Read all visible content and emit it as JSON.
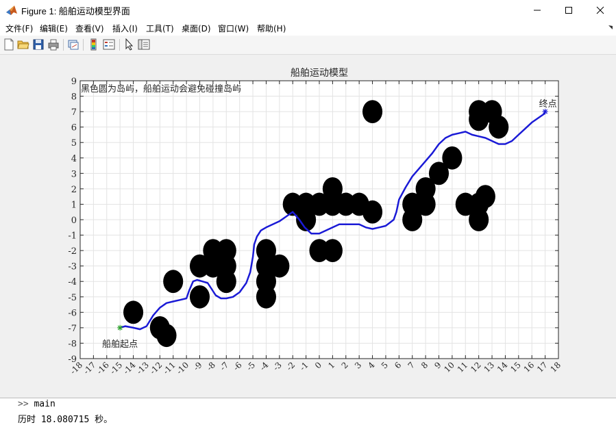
{
  "window": {
    "title": "Figure 1: 船舶运动模型界面"
  },
  "menu": [
    "文件(F)",
    "编辑(E)",
    "查看(V)",
    "插入(I)",
    "工具(T)",
    "桌面(D)",
    "窗口(W)",
    "帮助(H)"
  ],
  "toolbar": {
    "icons": [
      "new-figure-icon",
      "open-file-icon",
      "save-icon",
      "print-icon",
      "link-plot-icon",
      "colorbar-icon",
      "legend-icon",
      "edit-plot-icon",
      "property-inspector-icon"
    ]
  },
  "console": {
    "prompt": ">>",
    "command": "main",
    "output": "历时 18.080715 秒。"
  },
  "colors": {
    "path": "#1a1ad6",
    "island": "#000000",
    "start_marker": "#2ca02c",
    "end_marker": "#1a1ad6",
    "grid": "#e3e3e3",
    "axes_text": "#262626"
  },
  "chart_data": {
    "type": "line",
    "title": "船舶运动模型",
    "annotation": "黑色圆为岛屿，船舶运动会避免碰撞岛屿",
    "start_label": "船舶起点",
    "end_label": "终点",
    "xlim": [
      -18,
      18
    ],
    "ylim": [
      -9,
      9
    ],
    "x_ticks": [
      -18,
      -17,
      -16,
      -15,
      -14,
      -13,
      -12,
      -11,
      -10,
      -9,
      -8,
      -7,
      -6,
      -5,
      -4,
      -3,
      -2,
      -1,
      0,
      1,
      2,
      3,
      4,
      5,
      6,
      7,
      8,
      9,
      10,
      11,
      12,
      13,
      14,
      15,
      16,
      17,
      18
    ],
    "y_ticks": [
      -9,
      -8,
      -7,
      -6,
      -5,
      -4,
      -3,
      -2,
      -1,
      0,
      1,
      2,
      3,
      4,
      5,
      6,
      7,
      8,
      9
    ],
    "grid": true,
    "start": [
      -15,
      -7
    ],
    "end": [
      17,
      7
    ],
    "island_radius": 0.75,
    "islands": [
      [
        -14,
        -6
      ],
      [
        -12,
        -7
      ],
      [
        -11.5,
        -7.5
      ],
      [
        -11,
        -4
      ],
      [
        -9,
        -3
      ],
      [
        -9,
        -5
      ],
      [
        -8,
        -2
      ],
      [
        -8,
        -3
      ],
      [
        -7,
        -2
      ],
      [
        -7,
        -3
      ],
      [
        -7,
        -4
      ],
      [
        -4,
        -2
      ],
      [
        -4,
        -3
      ],
      [
        -4,
        -4
      ],
      [
        -4,
        -5
      ],
      [
        -3,
        -3
      ],
      [
        -2,
        1
      ],
      [
        -1,
        1
      ],
      [
        -1,
        0
      ],
      [
        0,
        1
      ],
      [
        1,
        1
      ],
      [
        1,
        2
      ],
      [
        2,
        1
      ],
      [
        3,
        1
      ],
      [
        4,
        0.5
      ],
      [
        4,
        7
      ],
      [
        0,
        -2
      ],
      [
        1,
        -2
      ],
      [
        7,
        1
      ],
      [
        7,
        0
      ],
      [
        8,
        1
      ],
      [
        8,
        2
      ],
      [
        9,
        3
      ],
      [
        10,
        4
      ],
      [
        11,
        1
      ],
      [
        12,
        1
      ],
      [
        12,
        0
      ],
      [
        12.5,
        1.5
      ],
      [
        12,
        7
      ],
      [
        12,
        6.5
      ],
      [
        13,
        7
      ],
      [
        13.5,
        6
      ]
    ],
    "series": [
      {
        "x": [
          -15,
          -14.6,
          -14,
          -13.5,
          -13,
          -12.5,
          -12,
          -11.5,
          -11,
          -10.5,
          -10,
          -9.8,
          -9.5,
          -9.2,
          -8.8,
          -8.4,
          -8.1,
          -7.8,
          -7.4,
          -7,
          -6.5,
          -6,
          -5.5,
          -5.2,
          -5,
          -4.9,
          -4.7,
          -4.4,
          -4,
          -3.5,
          -3,
          -2.5,
          -2,
          -1.5,
          -1.1,
          -0.6,
          0,
          0.5,
          1,
          1.5,
          2,
          2.5,
          3,
          3.5,
          4,
          4.5,
          5,
          5.3,
          5.6,
          5.8,
          6,
          6.5,
          7,
          7.5,
          8,
          8.5,
          9,
          9.5,
          10,
          10.5,
          11,
          11.5,
          12,
          12.5,
          13,
          13.5,
          14,
          14.5,
          15,
          15.5,
          16,
          16.5,
          17
        ],
        "y": [
          -7,
          -6.9,
          -7,
          -7.1,
          -6.9,
          -6.2,
          -5.7,
          -5.4,
          -5.3,
          -5.2,
          -5.1,
          -4.6,
          -4,
          -3.9,
          -4,
          -4.1,
          -4.5,
          -4.9,
          -5.1,
          -5.1,
          -5,
          -4.7,
          -4.1,
          -3.4,
          -2.4,
          -1.6,
          -1.1,
          -0.7,
          -0.5,
          -0.3,
          -0.1,
          0.2,
          0.5,
          0,
          -0.5,
          -0.9,
          -0.9,
          -0.7,
          -0.5,
          -0.3,
          -0.3,
          -0.3,
          -0.3,
          -0.5,
          -0.6,
          -0.5,
          -0.4,
          -0.2,
          0,
          0.5,
          1.3,
          2.1,
          2.8,
          3.3,
          3.8,
          4.3,
          4.9,
          5.3,
          5.5,
          5.6,
          5.7,
          5.5,
          5.4,
          5.3,
          5.1,
          4.9,
          4.9,
          5.1,
          5.5,
          5.9,
          6.3,
          6.6,
          6.9
        ]
      }
    ]
  }
}
